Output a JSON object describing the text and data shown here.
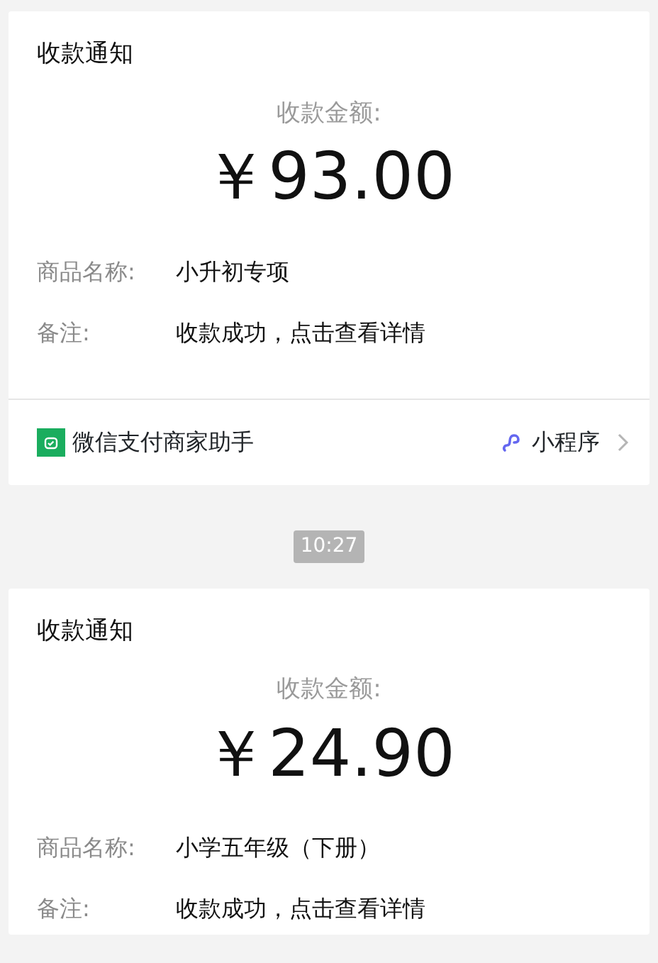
{
  "messages": [
    {
      "kind": "notice",
      "title": "收款通知",
      "amount_label": "收款金额:",
      "amount": "￥93.00",
      "fields": [
        {
          "label": "商品名称:",
          "value": "小升初专项"
        },
        {
          "label": "备注:",
          "value": "收款成功，点击查看详情"
        }
      ],
      "footer": {
        "source": "微信支付商家助手",
        "link": "小程序"
      }
    },
    {
      "kind": "time",
      "text": "10:27"
    },
    {
      "kind": "notice",
      "title": "收款通知",
      "amount_label": "收款金额:",
      "amount": "￥24.90",
      "fields": [
        {
          "label": "商品名称:",
          "value": "小学五年级（下册）"
        },
        {
          "label": "备注:",
          "value": "收款成功，点击查看详情"
        }
      ]
    }
  ]
}
